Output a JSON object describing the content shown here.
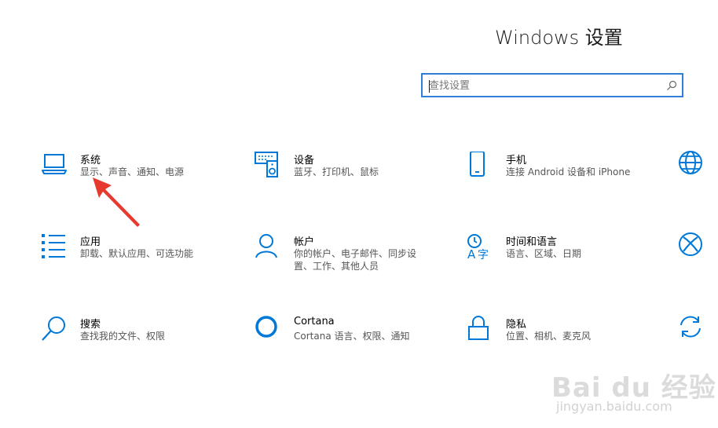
{
  "header": {
    "title": "Windows 设置"
  },
  "search": {
    "placeholder": "查找设置"
  },
  "tiles": [
    {
      "title": "系统",
      "desc": "显示、声音、通知、电源",
      "icon": "laptop-icon"
    },
    {
      "title": "设备",
      "desc": "蓝牙、打印机、鼠标",
      "icon": "devices-icon"
    },
    {
      "title": "手机",
      "desc": "连接 Android 设备和 iPhone",
      "icon": "phone-icon"
    },
    {
      "title": "应用",
      "desc": "卸载、默认应用、可选功能",
      "icon": "apps-icon"
    },
    {
      "title": "帐户",
      "desc": "你的帐户、电子邮件、同步设置、工作、其他人员",
      "desc_line1": "你的帐户、电子邮件、同步设",
      "desc_line2": "置、工作、其他人员",
      "icon": "person-icon"
    },
    {
      "title": "时间和语言",
      "desc": "语言、区域、日期",
      "icon": "time-language-icon"
    },
    {
      "title": "搜索",
      "desc": "查找我的文件、权限",
      "icon": "search-icon"
    },
    {
      "title": "Cortana",
      "desc": "Cortana 语言、权限、通知",
      "icon": "cortana-icon"
    },
    {
      "title": "隐私",
      "desc": "位置、相机、麦克风",
      "icon": "lock-icon"
    }
  ],
  "watermark": {
    "logo": "Bai du 经验",
    "url": "jingyan.baidu.com"
  },
  "colors": {
    "accent": "#0078d7",
    "search_border": "#2f7ed8",
    "arrow": "#e8392f"
  }
}
